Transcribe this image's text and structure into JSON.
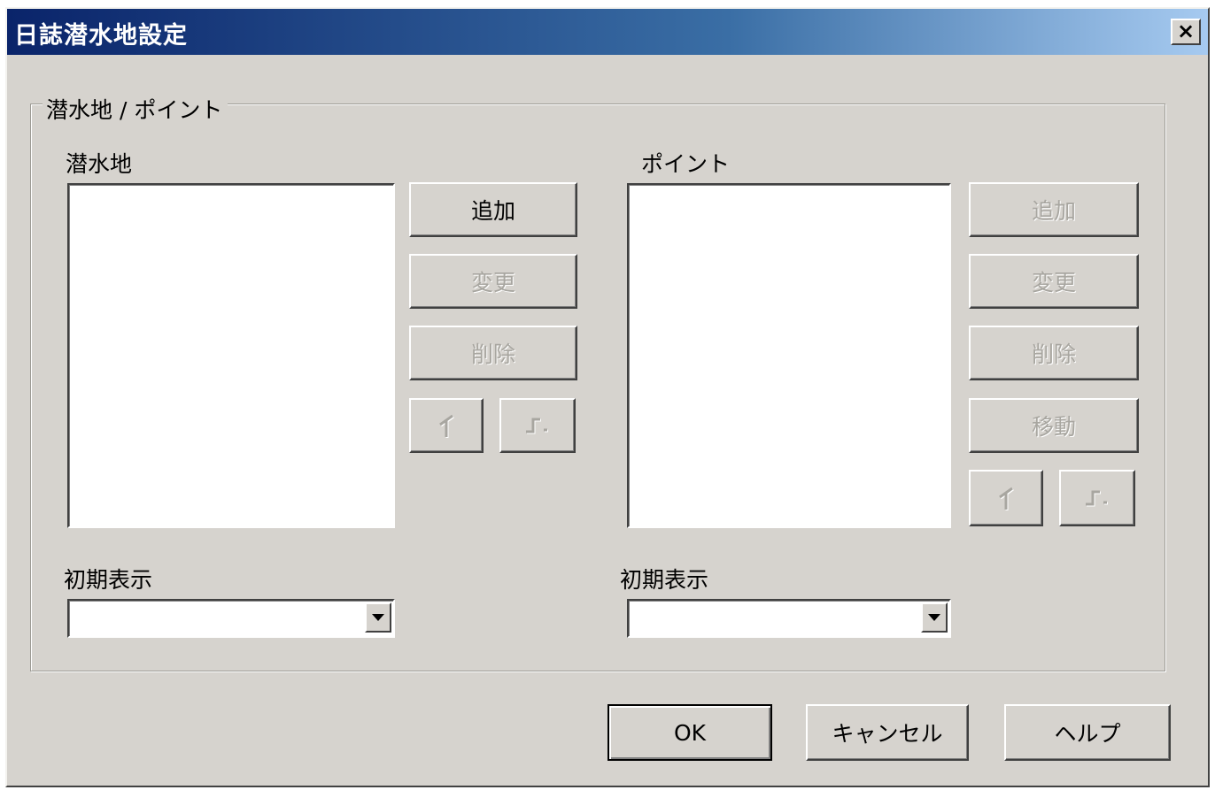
{
  "window": {
    "title": "日誌潜水地設定",
    "close_label": "×"
  },
  "group": {
    "legend": "潜水地 / ポイント"
  },
  "dive_sites": {
    "label": "潜水地",
    "items": [],
    "add_label": "追加",
    "change_label": "変更",
    "delete_label": "削除",
    "move_up_icon": "move-up-arrow",
    "move_down_icon": "move-down-arrow",
    "initial_label": "初期表示",
    "initial_value": ""
  },
  "points": {
    "label": "ポイント",
    "items": [],
    "add_label": "追加",
    "change_label": "変更",
    "delete_label": "削除",
    "move_label": "移動",
    "move_up_icon": "move-up-arrow",
    "move_down_icon": "move-down-arrow",
    "initial_label": "初期表示",
    "initial_value": ""
  },
  "footer": {
    "ok_label": "OK",
    "cancel_label": "キャンセル",
    "help_label": "ヘルプ"
  },
  "colors": {
    "face": "#d6d3ce",
    "title_start": "#0a246a",
    "title_end": "#a6caf0",
    "disabled_text": "#a8a6a0"
  }
}
